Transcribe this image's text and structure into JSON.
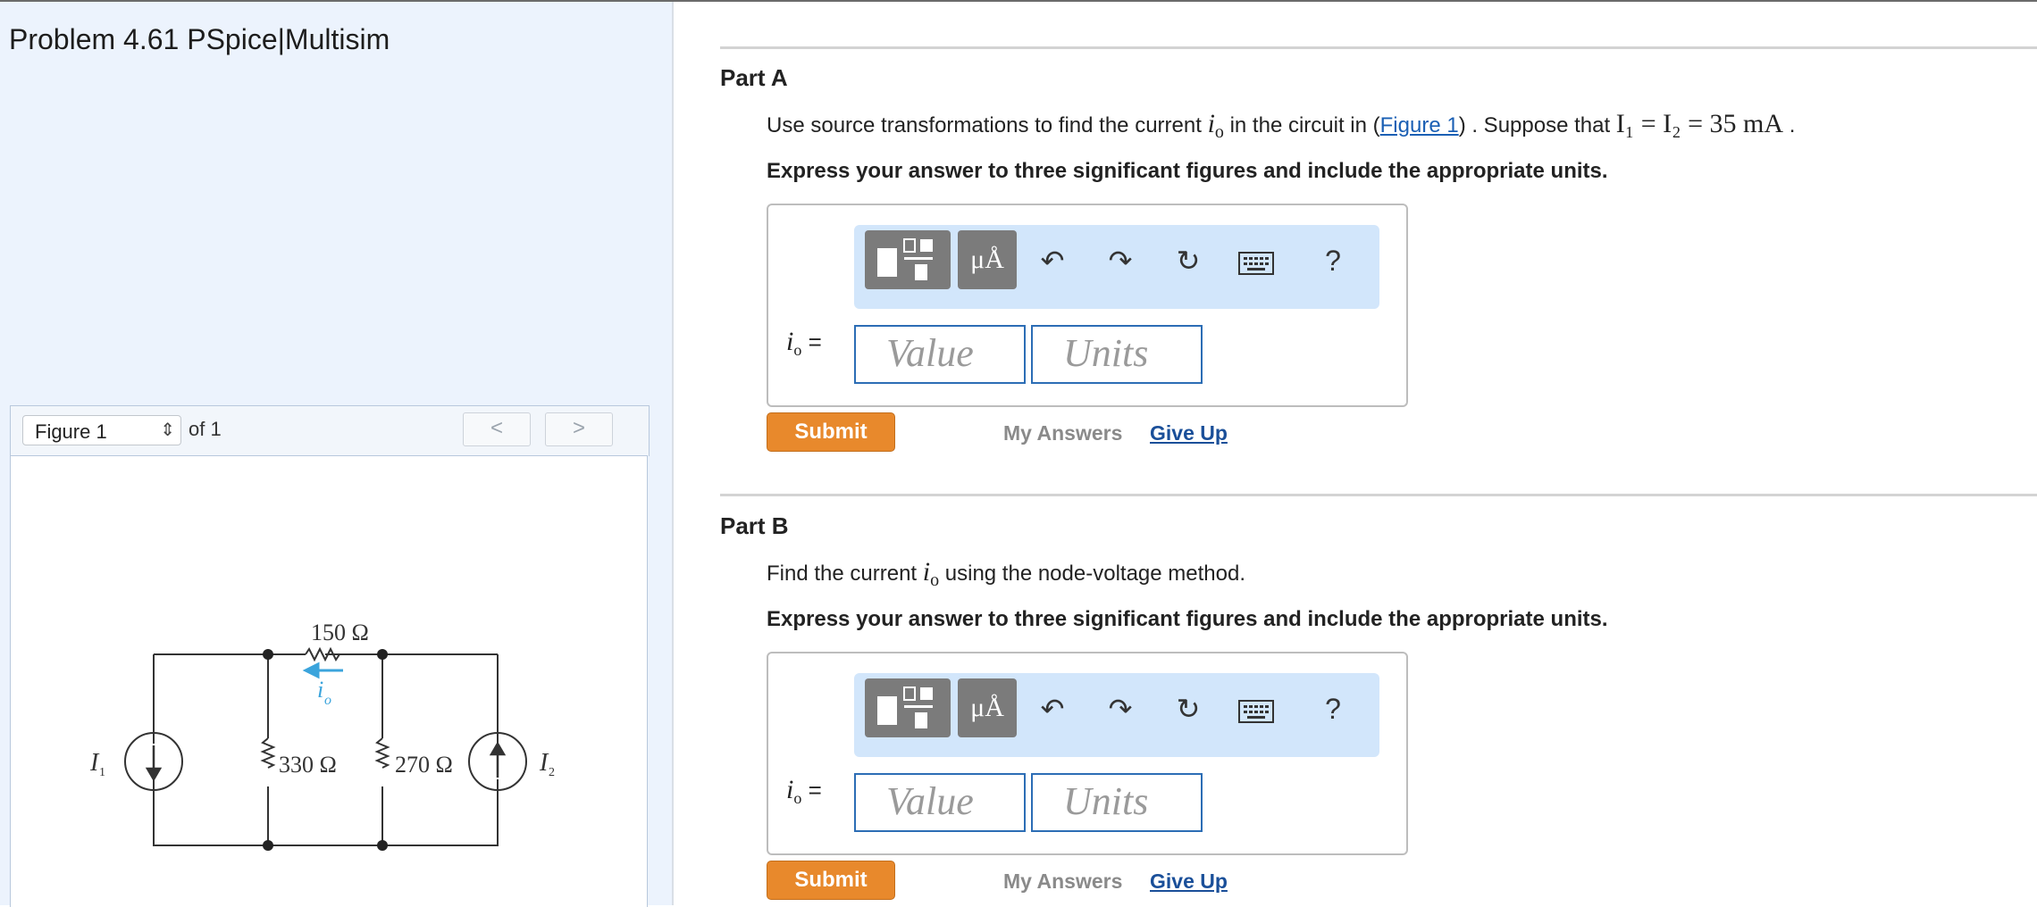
{
  "problem": {
    "title": "Problem 4.61 PSpice|Multisim"
  },
  "figure_nav": {
    "selected": "Figure 1",
    "of_label": "of 1",
    "prev_glyph": "<",
    "next_glyph": ">"
  },
  "circuit": {
    "r_top": "150 Ω",
    "r_left": "330 Ω",
    "r_right": "270 Ω",
    "source1_label": "I",
    "source1_sub": "1",
    "source2_label": "I",
    "source2_sub": "2",
    "current_label": "i",
    "current_sub": "o"
  },
  "partA": {
    "title": "Part A",
    "prompt_pre": "Use source transformations to find the current ",
    "var": "i",
    "var_sub": "o",
    "prompt_mid": " in the circuit in (",
    "figure_link": "Figure 1",
    "prompt_post": ") . Suppose that ",
    "math": "I₁ = I₂ = 35  mA",
    "prompt_end": " .",
    "instruction": "Express your answer to three significant figures and include the appropriate units.",
    "answer_label": "=",
    "value_placeholder": "Value",
    "units_placeholder": "Units",
    "submit": "Submit",
    "my_answers": "My Answers",
    "give_up": "Give Up"
  },
  "partB": {
    "title": "Part B",
    "prompt_pre": "Find the current ",
    "var": "i",
    "var_sub": "o",
    "prompt_post": " using the node-voltage method.",
    "instruction": "Express your answer to three significant figures and include the appropriate units.",
    "answer_label": "=",
    "value_placeholder": "Value",
    "units_placeholder": "Units",
    "submit": "Submit",
    "my_answers": "My Answers",
    "give_up": "Give Up"
  },
  "toolbar": {
    "units_glyph": "μÅ",
    "undo_icon": "undo-icon",
    "redo_icon": "redo-icon",
    "reset_icon": "reset-icon",
    "keyboard_icon": "keyboard-icon",
    "help_glyph": "?"
  },
  "colors": {
    "submit_bg": "#e8892c",
    "link": "#1a5fb4",
    "toolbar_bg": "#d2e6fb",
    "input_border": "#2c6db5",
    "left_bg": "#ecf3fd"
  }
}
